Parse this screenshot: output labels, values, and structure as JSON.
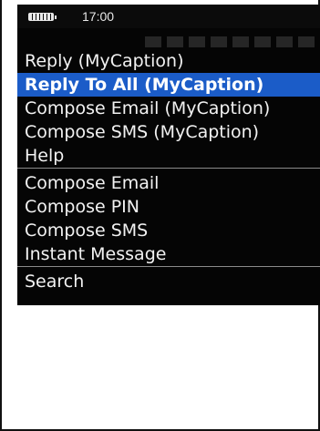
{
  "status_bar": {
    "time": "17:00",
    "battery_icon": "battery-icon"
  },
  "menu": {
    "group_1": [
      {
        "label": "Reply (MyCaption)",
        "selected": false
      },
      {
        "label": "Reply To All (MyCaption)",
        "selected": true
      },
      {
        "label": "Compose Email (MyCaption)",
        "selected": false
      },
      {
        "label": "Compose SMS (MyCaption)",
        "selected": false
      },
      {
        "label": "Help",
        "selected": false
      }
    ],
    "group_2": [
      {
        "label": "Compose Email",
        "selected": false
      },
      {
        "label": "Compose PIN",
        "selected": false
      },
      {
        "label": "Compose SMS",
        "selected": false
      },
      {
        "label": "Instant Message",
        "selected": false
      }
    ],
    "group_3": [
      {
        "label": "Search",
        "selected": false
      }
    ]
  },
  "colors": {
    "highlight": "#1b5cc8",
    "menu_background": "#050505",
    "menu_text": "#f2f2f2"
  }
}
